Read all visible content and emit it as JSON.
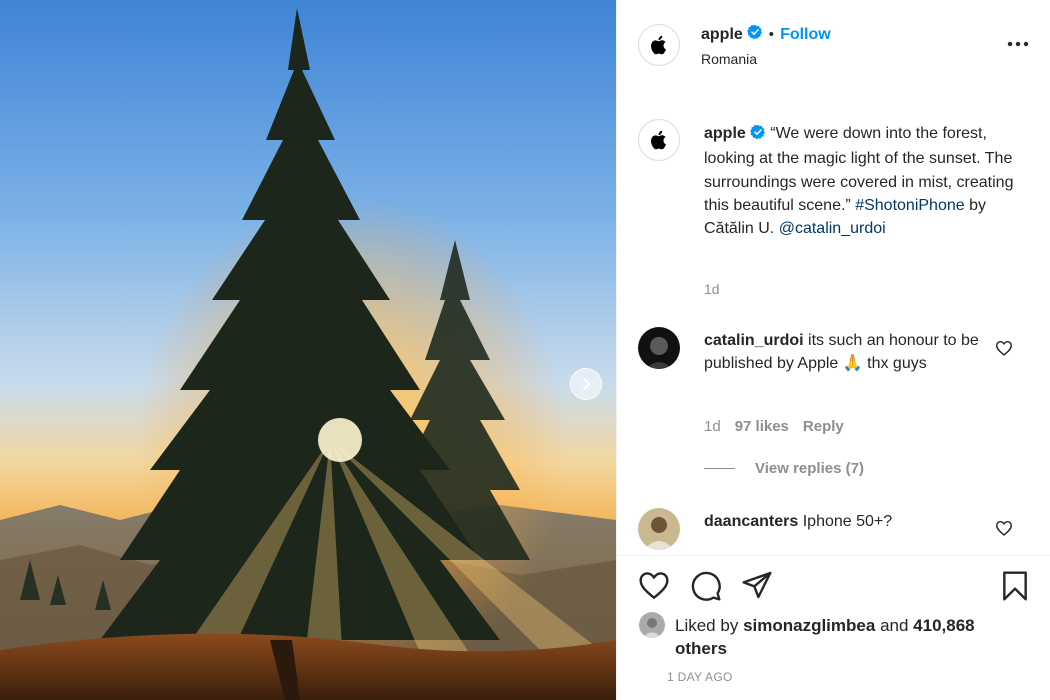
{
  "post": {
    "username": "apple",
    "location": "Romania",
    "follow_dot": "•",
    "follow_label": "Follow"
  },
  "caption": {
    "username": "apple",
    "text_main": "“We were down into the forest, looking at the magic light of the sunset. The surroundings were covered in mist, creating this beautiful scene.”",
    "hashtag": "#ShotoniPhone",
    "by_text": "by Cătălin U.",
    "mention": "@catalin_urdoi",
    "time": "1d"
  },
  "comments": [
    {
      "username": "catalin_urdoi",
      "text": "its such an honour to be published by Apple 🙏 thx guys",
      "time": "1d",
      "likes": "97 likes",
      "reply_label": "Reply",
      "view_replies": "View replies (7)"
    },
    {
      "username": "daancanters",
      "text": "Iphone 50+?"
    }
  ],
  "liked": {
    "prefix": "Liked by",
    "user": "simonazglimbea",
    "and": "and",
    "count": "410,868 others"
  },
  "time_ago": "1 DAY AGO",
  "colors": {
    "accent": "#0095f6",
    "link": "#00376b",
    "muted": "#8e8e8e",
    "text": "#262626"
  },
  "icons": [
    "apple-logo-icon",
    "verified-badge-icon",
    "more-options-icon",
    "heart-icon",
    "comment-icon",
    "share-icon",
    "bookmark-icon",
    "chevron-right-icon"
  ]
}
